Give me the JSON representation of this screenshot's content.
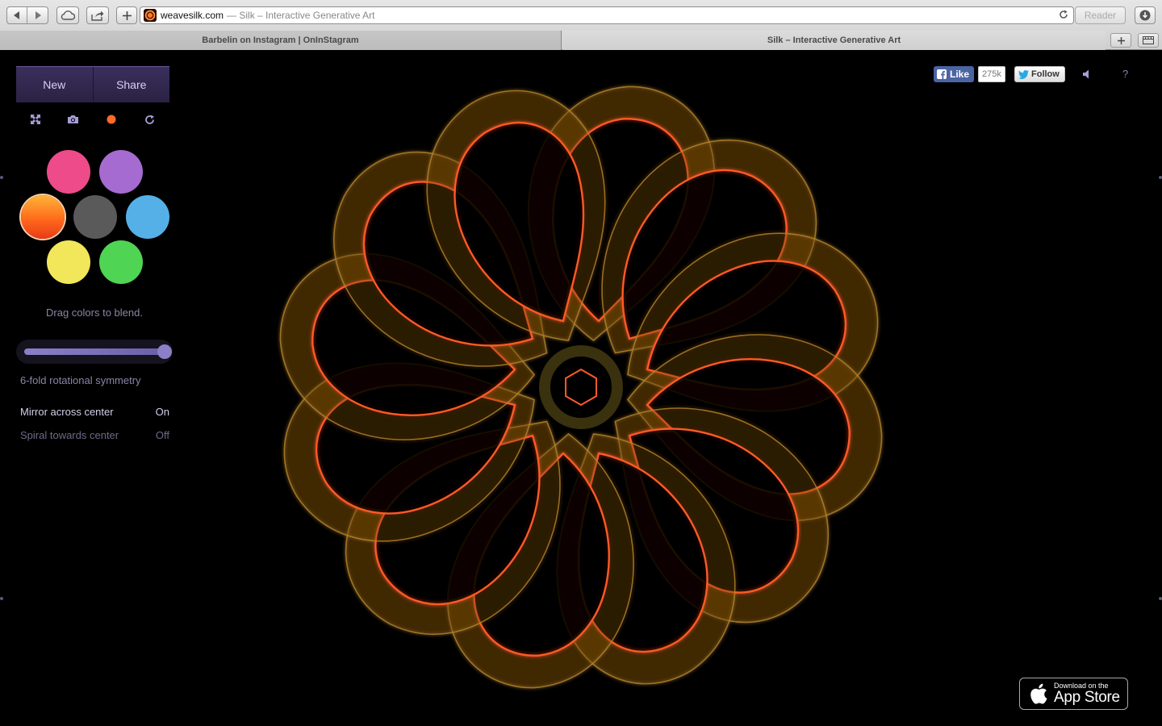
{
  "browser": {
    "url_domain": "weavesilk.com",
    "url_title": "— Silk – Interactive Generative Art",
    "reader_label": "Reader",
    "tabs": [
      {
        "label": "Barbelin on Instagram | OnInStagram"
      },
      {
        "label": "Silk – Interactive Generative Art"
      }
    ]
  },
  "app": {
    "new_label": "New",
    "share_label": "Share",
    "tools": [
      {
        "icon": "fullscreen-icon"
      },
      {
        "icon": "camera-icon"
      },
      {
        "icon": "color-dot-icon"
      },
      {
        "icon": "refresh-icon"
      }
    ],
    "colors": {
      "pink": "#ee4b8a",
      "purple": "#a66bd0",
      "orange": "#ff6a1a",
      "gray": "#5a5a5a",
      "blue": "#55b0e8",
      "yellow": "#f2e75a",
      "green": "#4fd454"
    },
    "selected_color": "orange",
    "blend_hint": "Drag colors to blend.",
    "symmetry_value": 6,
    "symmetry_label": "6-fold rotational symmetry",
    "options": [
      {
        "label": "Mirror across center",
        "state": "On"
      },
      {
        "label": "Spiral towards center",
        "state": "Off"
      }
    ]
  },
  "social": {
    "like_label": "Like",
    "like_count": "275k",
    "follow_label": "Follow",
    "help_label": "?"
  },
  "appstore": {
    "small": "Download on the",
    "big": "App Store"
  }
}
